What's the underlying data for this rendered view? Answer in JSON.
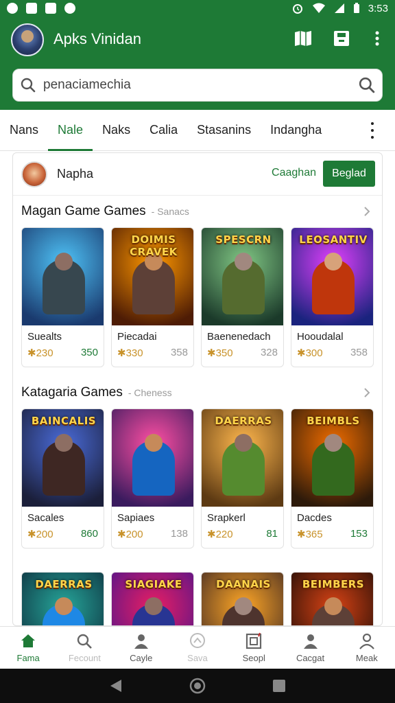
{
  "status_bar": {
    "time": "3:53"
  },
  "app": {
    "title": "Apks Vinidan"
  },
  "search": {
    "value": "penaciamechia",
    "placeholder": "penaciamechia"
  },
  "tabs": [
    "Nans",
    "Nale",
    "Naks",
    "Calia",
    "Stasanins",
    "Indangha"
  ],
  "active_tab": 1,
  "user": {
    "name": "Napha",
    "link_label": "Caaghan",
    "button_label": "Beglad"
  },
  "sections": [
    {
      "title": "Magan Game Games",
      "subtitle": "- Sanacs",
      "games": [
        {
          "name": "Suealts",
          "price": "✱230",
          "count": "350",
          "count_color": "green",
          "thumb_title": "",
          "bg": [
            "#4fc3f7",
            "#1a3a6e"
          ],
          "fig": "#37474f",
          "head": "#8d6e63"
        },
        {
          "name": "Piecadai",
          "price": "✱330",
          "count": "358",
          "count_color": "grey",
          "thumb_title": "DOIMIS CRAVEK",
          "bg": [
            "#ff9800",
            "#4e1c05"
          ],
          "fig": "#5d4037",
          "head": "#c68a5a"
        },
        {
          "name": "Baenenedach",
          "price": "✱350",
          "count": "328",
          "count_color": "grey",
          "thumb_title": "SPESCRN",
          "bg": [
            "#81c784",
            "#1b3a2a"
          ],
          "fig": "#556b2f",
          "head": "#a1887f"
        },
        {
          "name": "Hooudalal",
          "price": "✱300",
          "count": "358",
          "count_color": "grey",
          "thumb_title": "LEOSANTIV",
          "bg": [
            "#e040fb",
            "#1a237e"
          ],
          "fig": "#bf360c",
          "head": "#d7a27a"
        }
      ]
    },
    {
      "title": "Katagaria Games",
      "subtitle": "- Cheness",
      "games": [
        {
          "name": "Sacales",
          "price": "✱200",
          "count": "860",
          "count_color": "green",
          "thumb_title": "BAINCALIS",
          "bg": [
            "#4a6bd8",
            "#1b1f3a"
          ],
          "fig": "#3e2723",
          "head": "#8d6e63"
        },
        {
          "name": "Sapiaes",
          "price": "✱200",
          "count": "138",
          "count_color": "grey",
          "thumb_title": "",
          "bg": [
            "#ff4fa3",
            "#3a1b5e"
          ],
          "fig": "#1565c0",
          "head": "#c68a5a"
        },
        {
          "name": "Srapkerl",
          "price": "✱220",
          "count": "81",
          "count_color": "green",
          "thumb_title": "DAERRAS",
          "bg": [
            "#ffb74d",
            "#5d3a13"
          ],
          "fig": "#558b2f",
          "head": "#8d6e63"
        },
        {
          "name": "Dacdes",
          "price": "✱365",
          "count": "153",
          "count_color": "green",
          "thumb_title": "BEIMBLS",
          "bg": [
            "#ef6c00",
            "#2d1a0a"
          ],
          "fig": "#33691e",
          "head": "#a1887f"
        }
      ]
    },
    {
      "title": "",
      "subtitle": "",
      "games": [
        {
          "thumb_title": "DAERRAS",
          "bg": [
            "#26a69a",
            "#0d2b3a"
          ],
          "fig": "#1e88e5",
          "head": "#c68a5a"
        },
        {
          "thumb_title": "SIAGIAKE",
          "bg": [
            "#e91e63",
            "#4a148c"
          ],
          "fig": "#283593",
          "head": "#8d6e63"
        },
        {
          "thumb_title": "DAANAIS",
          "bg": [
            "#ffa726",
            "#3e2723"
          ],
          "fig": "#4e342e",
          "head": "#a1887f"
        },
        {
          "thumb_title": "BEIMBERS",
          "bg": [
            "#d84315",
            "#1a0a05"
          ],
          "fig": "#5d4037",
          "head": "#c68a5a"
        }
      ]
    }
  ],
  "bottom_nav": [
    {
      "label": "Fama",
      "icon": "home-icon",
      "state": "active"
    },
    {
      "label": "Fecount",
      "icon": "search-icon",
      "state": "faded"
    },
    {
      "label": "Cayle",
      "icon": "person-icon",
      "state": "normal"
    },
    {
      "label": "Sava",
      "icon": "save-icon",
      "state": "faded"
    },
    {
      "label": "Seopl",
      "icon": "store-icon",
      "state": "normal"
    },
    {
      "label": "Cacgat",
      "icon": "person-icon",
      "state": "normal"
    },
    {
      "label": "Meak",
      "icon": "account-icon",
      "state": "normal"
    }
  ],
  "colors": {
    "primary": "#1e7a36",
    "price": "#c8922a"
  }
}
